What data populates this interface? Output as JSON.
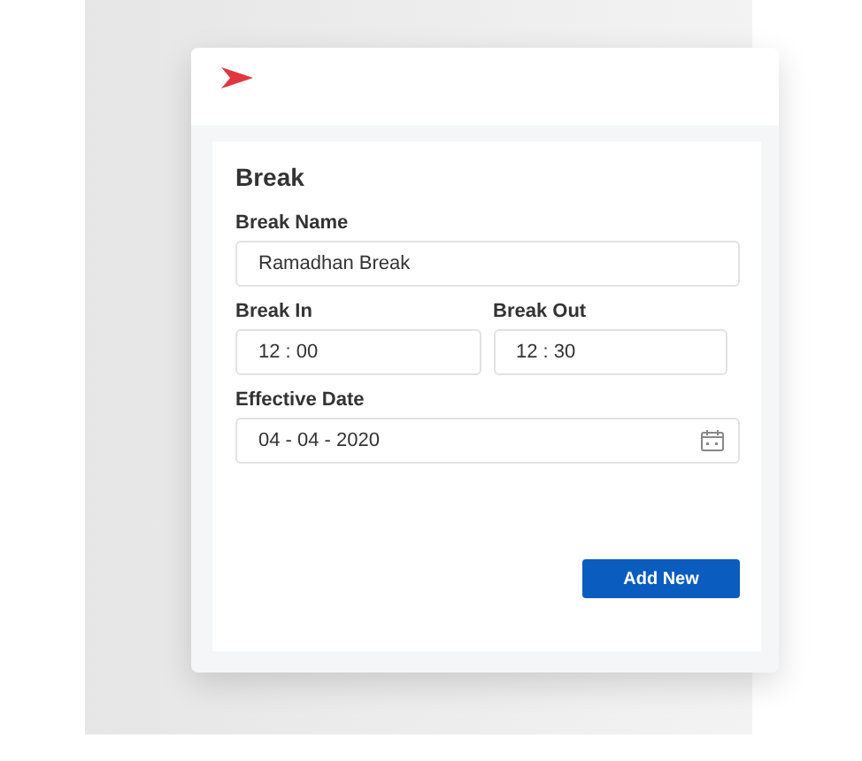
{
  "form": {
    "title": "Break",
    "fields": [
      {
        "kind": "text",
        "label": "Break Name",
        "value": "Ramadhan Break"
      },
      {
        "kind": "time",
        "label": "Break In",
        "value": "12 : 00"
      },
      {
        "kind": "time",
        "label": "Break Out",
        "value": "12 : 30"
      },
      {
        "kind": "date",
        "label": "Effective Date",
        "value": "04 - 04 - 2020"
      }
    ],
    "button": "Add New"
  }
}
